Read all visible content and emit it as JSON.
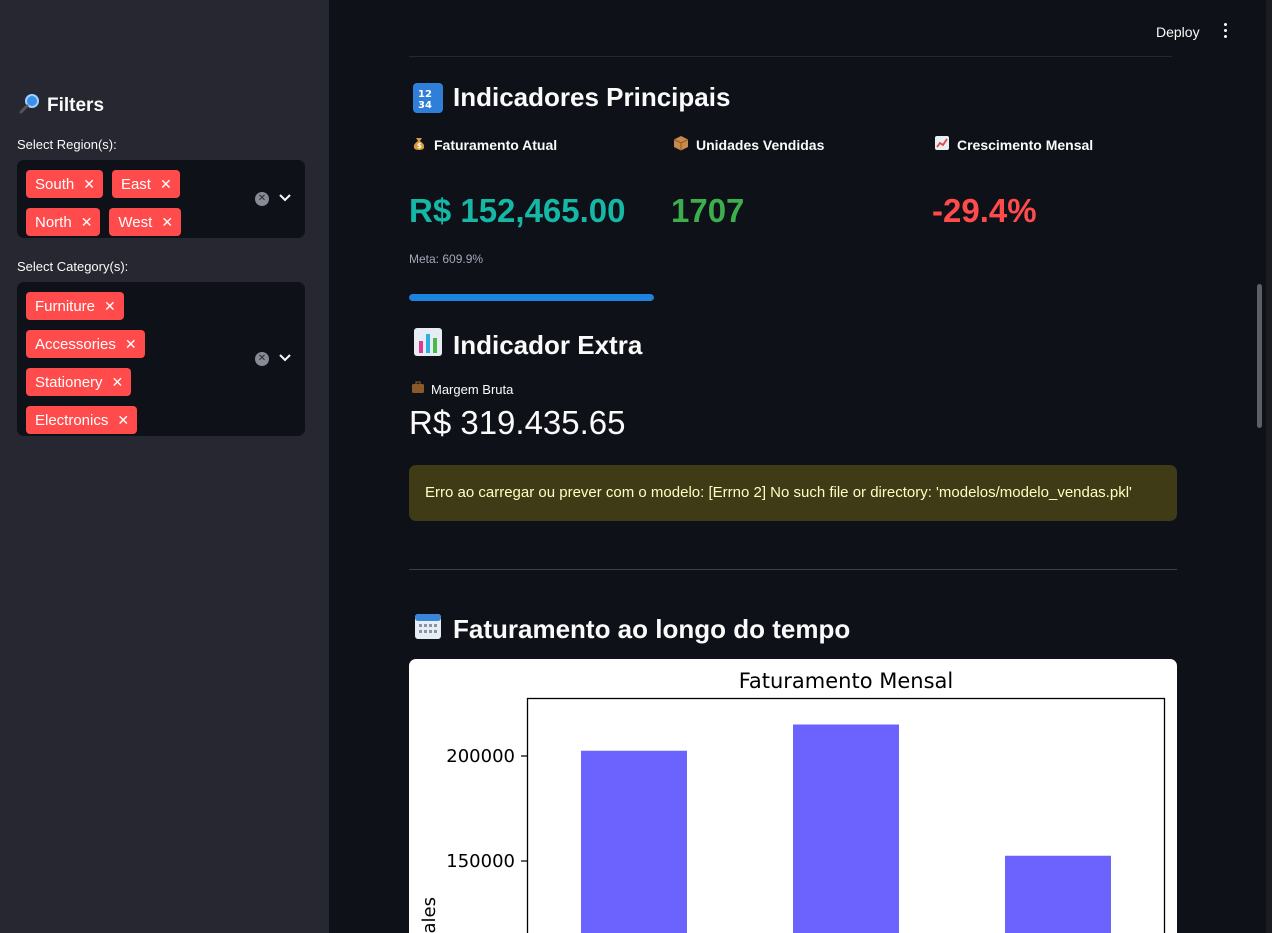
{
  "header": {
    "deploy_label": "Deploy"
  },
  "sidebar": {
    "title": "Filters",
    "title_icon": "magnifier-icon",
    "region": {
      "label": "Select Region(s):",
      "chips": [
        "South",
        "East",
        "North",
        "West"
      ]
    },
    "category": {
      "label": "Select Category(s):",
      "chips": [
        "Furniture",
        "Accessories",
        "Stationery",
        "Electronics"
      ]
    }
  },
  "main": {
    "indicadores": {
      "title": "Indicadores Principais",
      "icon_text": "1234",
      "metrics": [
        {
          "label": "Faturamento Atual",
          "icon": "money-bag-icon",
          "value": "R$ 152,465.00",
          "color": "#15b8a6"
        },
        {
          "label": "Unidades Vendidas",
          "icon": "package-icon",
          "value": "1707",
          "color": "#3dae4e"
        },
        {
          "label": "Crescimento Mensal",
          "icon": "chart-up-icon",
          "value": "-29.4%",
          "color": "#ff4b4b"
        }
      ],
      "meta_text": "Meta: 609.9%",
      "progress_fraction": 1.0
    },
    "extra": {
      "title": "Indicador Extra",
      "margem_label": "Margem Bruta",
      "margem_value": "R$ 319.435.65"
    },
    "error_text": "Erro ao carregar ou prever com o modelo: [Errno 2] No such file or directory: 'modelos/modelo_vendas.pkl'",
    "timeline": {
      "title": "Faturamento ao longo do tempo"
    }
  },
  "chart_data": {
    "type": "bar",
    "title": "Faturamento Mensal",
    "ylabel": "Sales",
    "values": [
      202500,
      215000,
      152500
    ],
    "yticks": [
      "200000",
      "150000"
    ],
    "ytick_values": [
      200000,
      150000
    ],
    "bar_color": "#6c63ff"
  }
}
